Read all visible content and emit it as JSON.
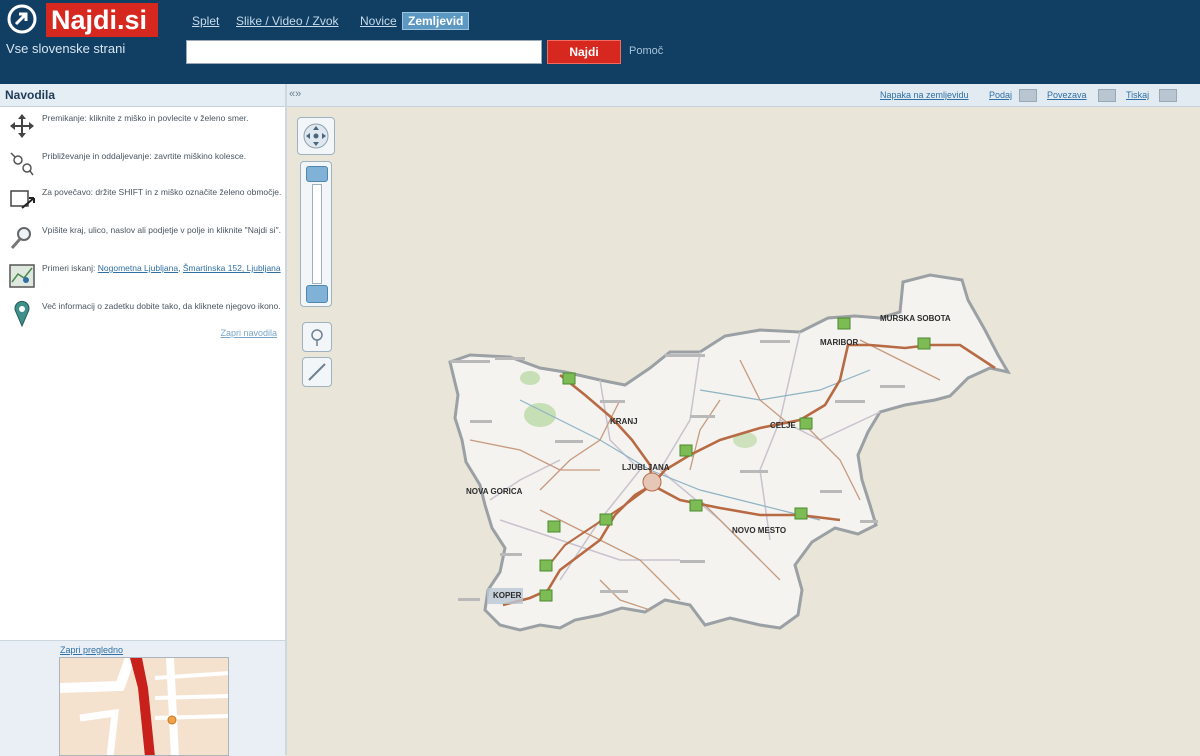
{
  "header": {
    "logo": "Najdi.si",
    "tagline": "Vse slovenske strani",
    "nav": [
      {
        "label": "Splet"
      },
      {
        "label": "Slike / Video / Zvok"
      },
      {
        "label": "Novice"
      },
      {
        "label": "Zemljevid"
      }
    ],
    "search_value": "",
    "search_button": "Najdi",
    "help_link": "Pomoč"
  },
  "sidebar": {
    "title": "Navodila",
    "instructions": [
      {
        "icon": "move-arrows-icon",
        "text": "Premikanje: kliknite z miško in povlecite v želeno smer."
      },
      {
        "icon": "zoom-icon",
        "text": "Približevanje in oddaljevanje: zavrtite miškino kolesce."
      },
      {
        "icon": "select-area-icon",
        "text": "Za povečavo: držite SHIFT in z miško označite želeno območje."
      },
      {
        "icon": "magnifier-icon",
        "text": "Vpišite kraj, ulico, naslov ali podjetje v polje in kliknite \"Najdi si\"."
      },
      {
        "icon": "map-view-icon",
        "text_pre": "Primeri iskanj:",
        "links": [
          "Nogometna Ljubljana",
          "Šmartinska 152, Ljubljana"
        ],
        "text_post": ""
      },
      {
        "icon": "info-pin-icon",
        "text": "Več informacij o zadetku dobite tako, da kliknete njegovo ikono."
      }
    ],
    "close_help": "Zapri navodila",
    "overview_label": "Zapri pregledno"
  },
  "map_toolbar": {
    "collapse": "«»",
    "links": [
      "Napaka na zemljevidu",
      "Podaj",
      "Povezava",
      "Tiskaj"
    ]
  },
  "map": {
    "cities": [
      "MURSKA SOBOTA",
      "MARIBOR",
      "KRANJ",
      "LJUBLJANA",
      "NOVA GORICA",
      "NOVO MESTO",
      "CELJE",
      "KOPER"
    ],
    "colors": {
      "land": "#f4f3ef",
      "border": "#9aa0a4",
      "highway": "#b76a43",
      "road": "#c69a7e",
      "water": "#8fb3c4",
      "forest": "#bcd9a6",
      "sign": "#7dbb55",
      "background": "#e9e6d9"
    }
  }
}
